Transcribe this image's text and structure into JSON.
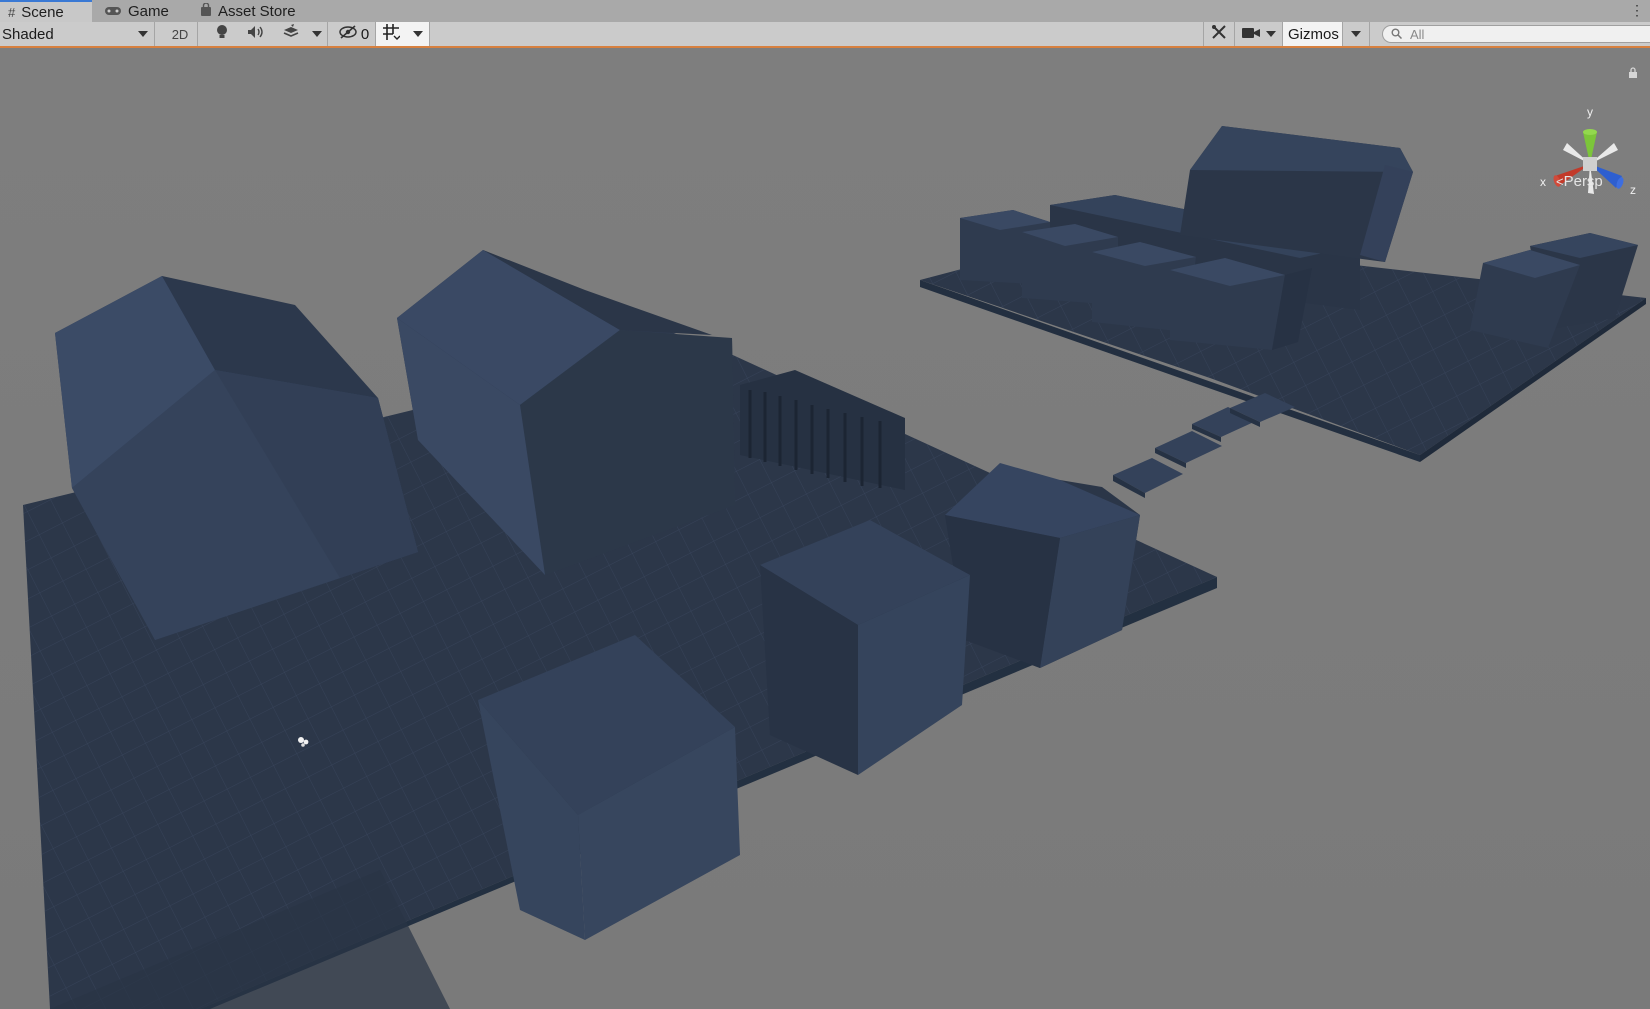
{
  "tabs": [
    {
      "label": "Scene",
      "icon": "hash-icon",
      "active": true
    },
    {
      "label": "Game",
      "icon": "gamepad-icon",
      "active": false
    },
    {
      "label": "Asset Store",
      "icon": "bag-icon",
      "active": false
    }
  ],
  "toolbar": {
    "draw_mode": "Shaded",
    "mode_2d": "2D",
    "hidden_count": "0",
    "gizmos": "Gizmos",
    "search_placeholder": "All"
  },
  "gizmo": {
    "x": "x",
    "y": "y",
    "z": "z",
    "projection": "Persp"
  },
  "colors": {
    "accent_tab": "#3a79d4",
    "toolbar_border": "#d7803f",
    "scene_bg": "#7c7c7c",
    "geometry": "#2f3b4d",
    "axis_x": "#c23a2a",
    "axis_y": "#7cc53a",
    "axis_z": "#2e5fd0"
  }
}
